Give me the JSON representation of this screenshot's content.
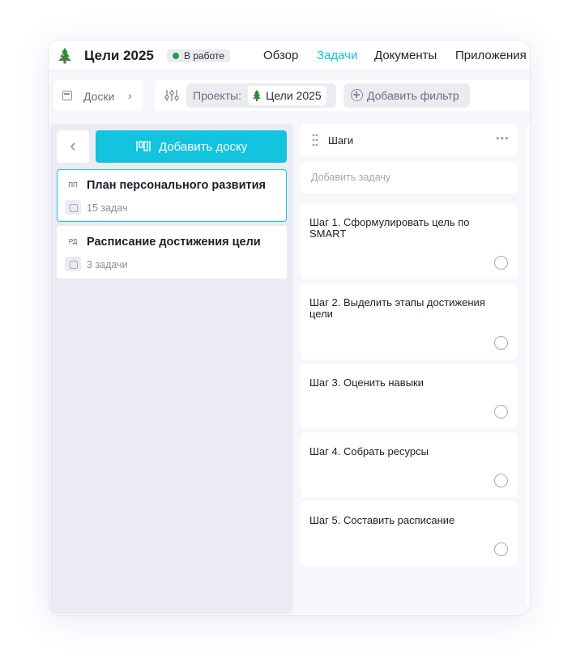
{
  "header": {
    "project_title": "Цели 2025",
    "status": "В работе",
    "status_color": "#1aa34a",
    "accent_color": "#14c3dd",
    "nav": [
      {
        "label": "Обзор",
        "active": false
      },
      {
        "label": "Задачи",
        "active": true
      },
      {
        "label": "Документы",
        "active": false
      },
      {
        "label": "Приложения",
        "active": false
      }
    ]
  },
  "filters": {
    "boards_label": "Доски",
    "projects_label": "Проекты:",
    "project_value": "Цели 2025",
    "add_filter_label": "Добавить фильтр"
  },
  "boards_panel": {
    "add_board_label": "Добавить доску",
    "boards": [
      {
        "abbr": "ПП",
        "name": "План персонального развития",
        "task_count": "15 задач",
        "selected": true
      },
      {
        "abbr": "РД",
        "name": "Расписание достижения цели",
        "task_count": "3 задачи",
        "selected": false
      }
    ]
  },
  "column": {
    "title": "Шаги",
    "more": "•••",
    "add_task_label": "Добавить задачу",
    "tasks": [
      {
        "title": "Шаг 1. Сформулировать цель по SMART"
      },
      {
        "title": "Шаг 2. Выделить этапы достижения цели"
      },
      {
        "title": "Шаг 3. Оценить навыки"
      },
      {
        "title": "Шаг 4. Собрать ресурсы"
      },
      {
        "title": "Шаг 5. Составить расписание"
      }
    ]
  }
}
